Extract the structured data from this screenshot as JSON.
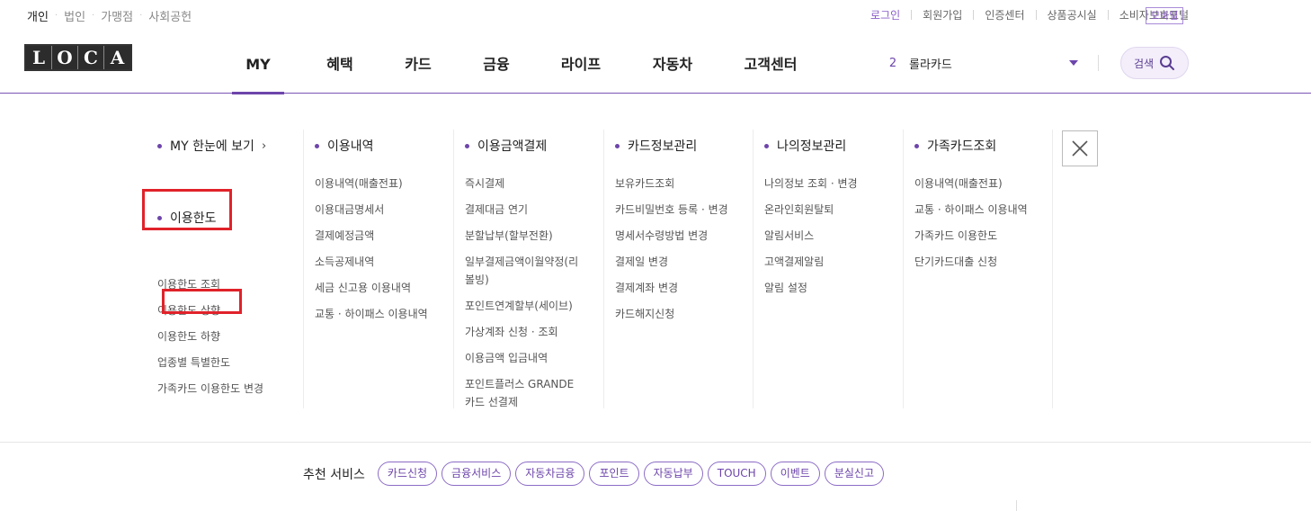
{
  "top_segments": [
    "개인",
    "법인",
    "가맹점",
    "사회공헌"
  ],
  "util_links": [
    "로그인",
    "회원가입",
    "인증센터",
    "상품공시실",
    "소비자보호포털"
  ],
  "mobile_label": "모바일",
  "logo_letters": [
    "L",
    "O",
    "C",
    "A"
  ],
  "gnb": [
    "MY",
    "혜택",
    "카드",
    "금융",
    "라이프",
    "자동차",
    "고객센터"
  ],
  "card_select": {
    "number": "2",
    "name": "롤라카드"
  },
  "search_label": "검색",
  "mega": {
    "col1": {
      "title": "MY 한눈에 보기",
      "title2": "이용한도",
      "items": [
        "이용한도 조회",
        "이용한도 상향",
        "이용한도 하향",
        "업종별 특별한도",
        "가족카드 이용한도 변경"
      ]
    },
    "col2": {
      "title": "이용내역",
      "items": [
        "이용내역(매출전표)",
        "이용대금명세서",
        "결제예정금액",
        "소득공제내역",
        "세금 신고용 이용내역",
        "교통 · 하이패스 이용내역"
      ]
    },
    "col3": {
      "title": "이용금액결제",
      "items": [
        "즉시결제",
        "결제대금 연기",
        "분할납부(할부전환)",
        "일부결제금액이월약정(리볼빙)",
        "포인트연계할부(세이브)",
        "가상계좌 신청 · 조회",
        "이용금액 입금내역",
        "포인트플러스 GRANDE카드 선결제"
      ]
    },
    "col4": {
      "title": "카드정보관리",
      "items": [
        "보유카드조회",
        "카드비밀번호 등록 · 변경",
        "명세서수령방법 변경",
        "결제일 변경",
        "결제계좌 변경",
        "카드해지신청"
      ]
    },
    "col5": {
      "title": "나의정보관리",
      "items": [
        "나의정보 조회 · 변경",
        "온라인회원탈퇴",
        "알림서비스",
        "고액결제알림",
        "알림 설정"
      ]
    },
    "col6": {
      "title": "가족카드조회",
      "items": [
        "이용내역(매출전표)",
        "교통 · 하이패스 이용내역",
        "가족카드 이용한도",
        "단기카드대출 신청"
      ]
    }
  },
  "reco": {
    "label": "추천 서비스",
    "chips": [
      "카드신청",
      "금융서비스",
      "자동차금융",
      "포인트",
      "자동납부",
      "TOUCH",
      "이벤트",
      "분실신고"
    ]
  },
  "colors": {
    "accent": "#6d45ab",
    "highlight": "#e0222a"
  }
}
